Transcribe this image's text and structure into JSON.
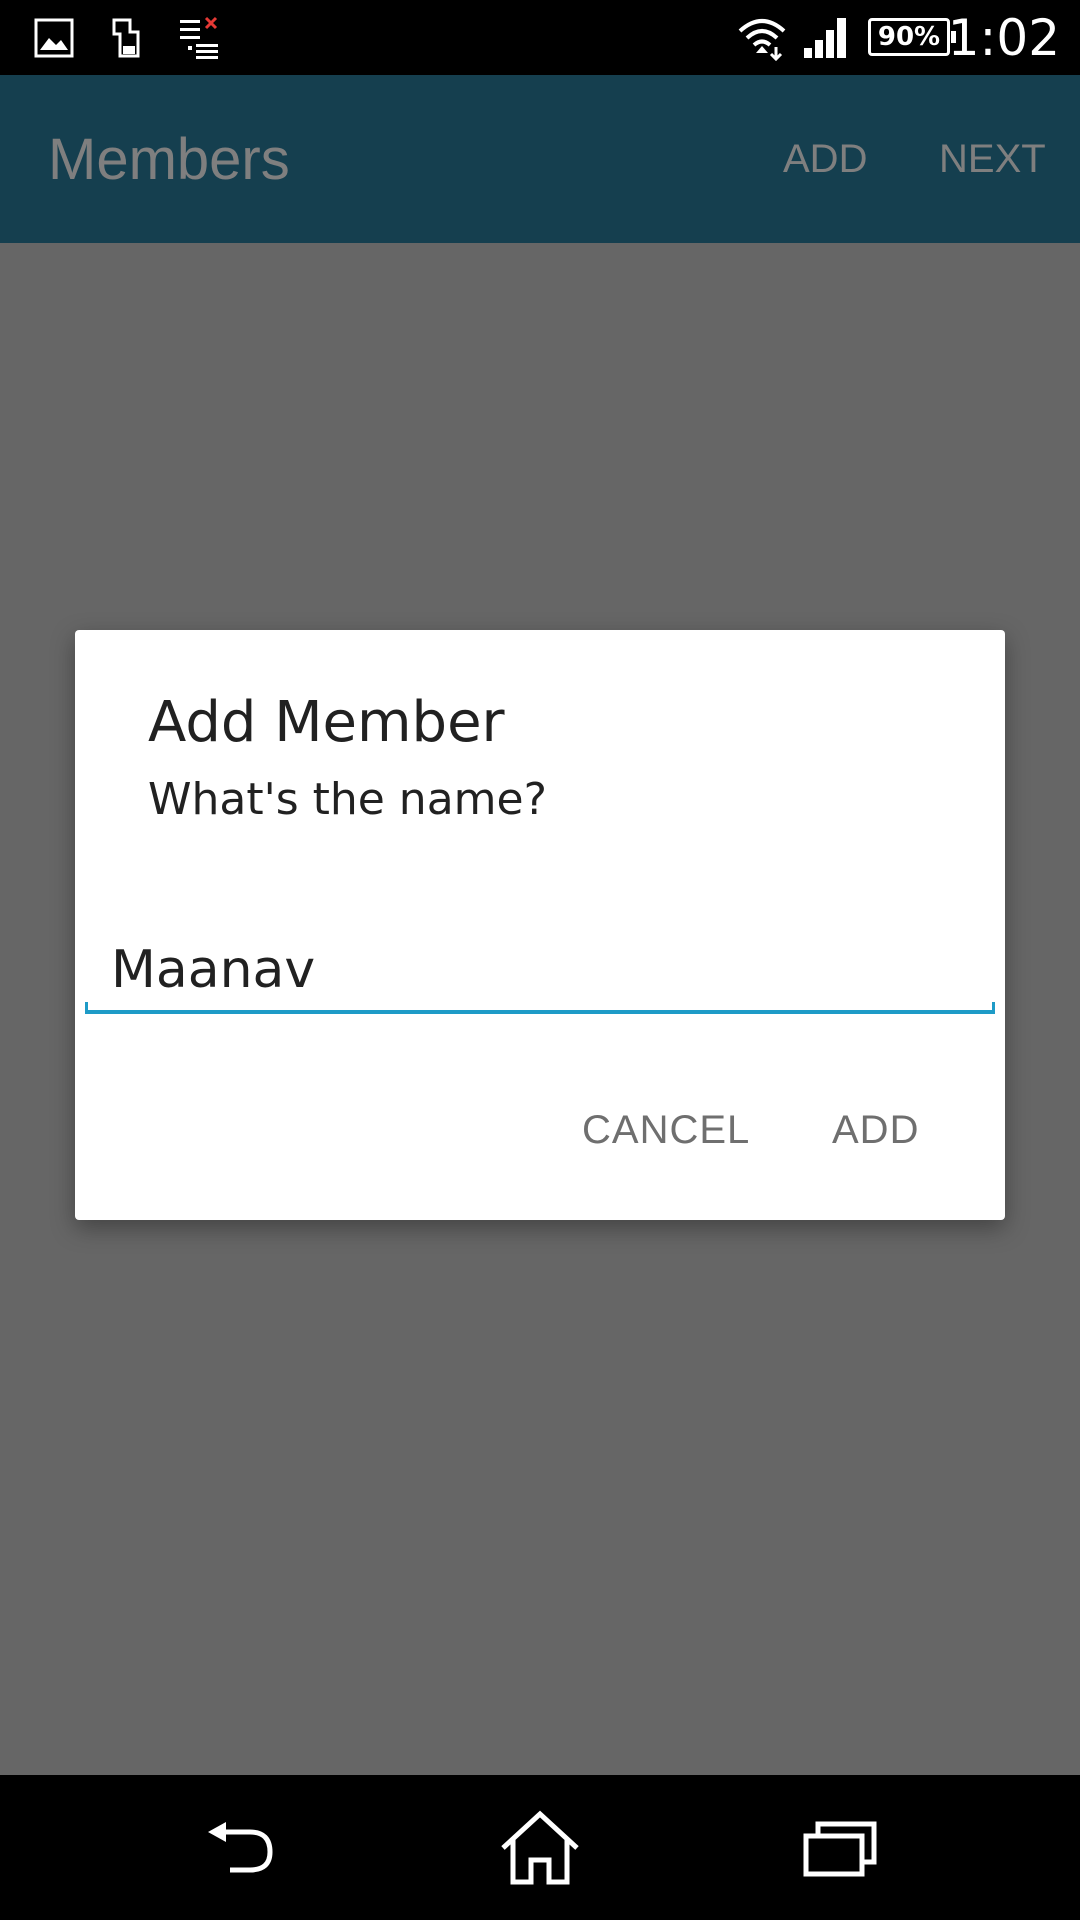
{
  "status_bar": {
    "time": "1:02",
    "battery_percent": "90%",
    "icons": [
      "gallery-icon",
      "sd-card-icon",
      "download-error-icon",
      "wifi-icon",
      "signal-icon",
      "battery-icon"
    ]
  },
  "app_bar": {
    "title": "Members",
    "actions": {
      "add": "ADD",
      "next": "NEXT"
    },
    "color": "#2a7f9e"
  },
  "dialog": {
    "title": "Add Member",
    "message": "What's the name?",
    "input": {
      "value": "Maanav",
      "accent_color": "#1e9bc7"
    },
    "buttons": {
      "cancel": "CANCEL",
      "add": "ADD"
    }
  },
  "nav_bar": {
    "icons": [
      "back-icon",
      "home-icon",
      "recent-apps-icon"
    ]
  }
}
